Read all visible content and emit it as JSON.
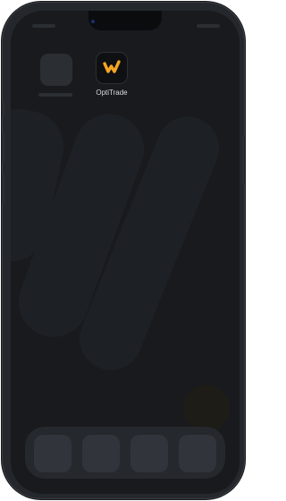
{
  "device": {
    "type": "smartphone"
  },
  "home_screen": {
    "apps": [
      {
        "label": "",
        "icon": "app-placeholder-icon",
        "placeholder": true
      },
      {
        "label": "OptiTrade",
        "icon": "optitrade-logo-icon",
        "brand_color": "#F5A623"
      }
    ],
    "dock": {
      "slots": 4
    }
  },
  "colors": {
    "screen_background": "#181a1e",
    "frame": "#24272c",
    "accent": "#F5A623"
  }
}
